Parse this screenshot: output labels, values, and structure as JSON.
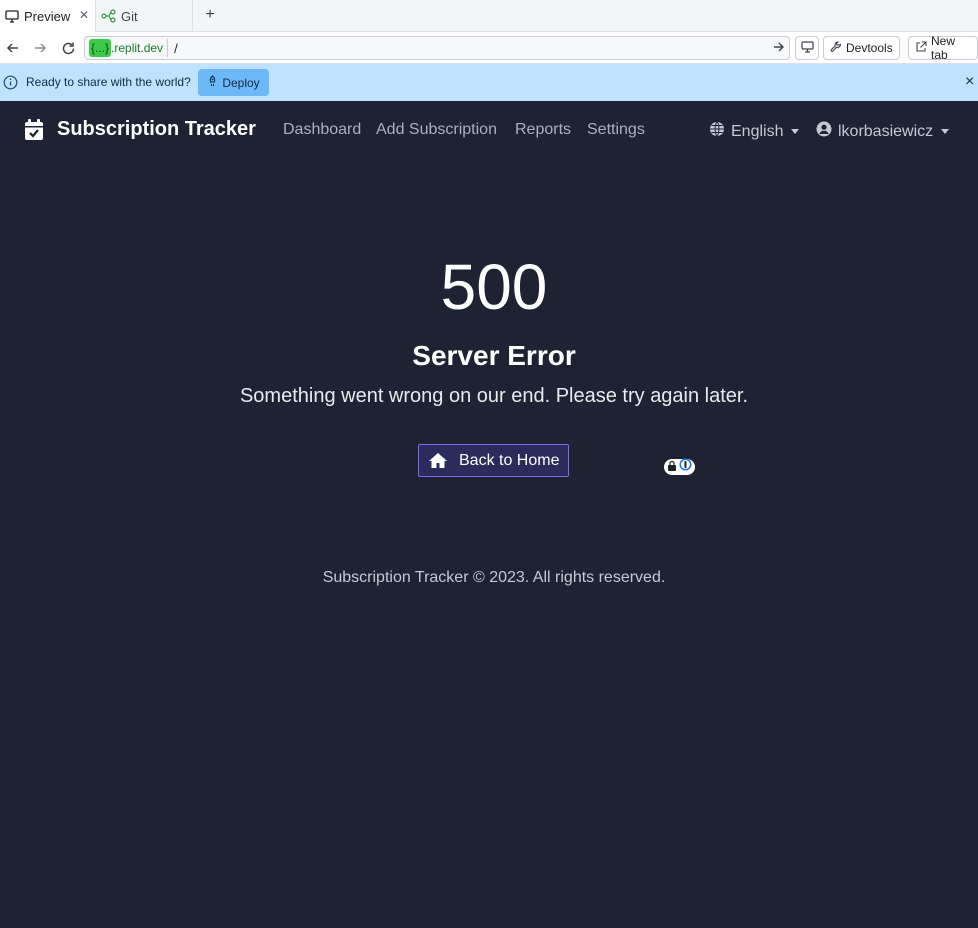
{
  "browser": {
    "tabs": [
      {
        "label": "Preview",
        "icon": "monitor-icon"
      },
      {
        "label": "Git",
        "icon": "git-branch-icon"
      }
    ],
    "new_tab_symbol": "+",
    "url_domain_badge": "{...}",
    "url_domain": ".replit.dev",
    "url_path": "/",
    "devtools_label": "Devtools",
    "new_tab_label": "New tab"
  },
  "banner": {
    "message": "Ready to share with the world?",
    "deploy_label": "Deploy",
    "close_symbol": "×"
  },
  "app": {
    "brand": "Subscription Tracker",
    "nav": [
      "Dashboard",
      "Add Subscription",
      "Reports",
      "Settings"
    ],
    "language": "English",
    "username": "lkorbasiewicz"
  },
  "error": {
    "code": "500",
    "title": "Server Error",
    "description": "Something went wrong on our end. Please try again later.",
    "home_button": "Back to Home"
  },
  "footer": {
    "text": "Subscription Tracker © 2023. All rights reserved."
  },
  "colors": {
    "background": "#1e2233",
    "banner": "#bfe3ff",
    "deploy_button": "#6db8f7",
    "home_button_border": "#7a6cf0"
  }
}
